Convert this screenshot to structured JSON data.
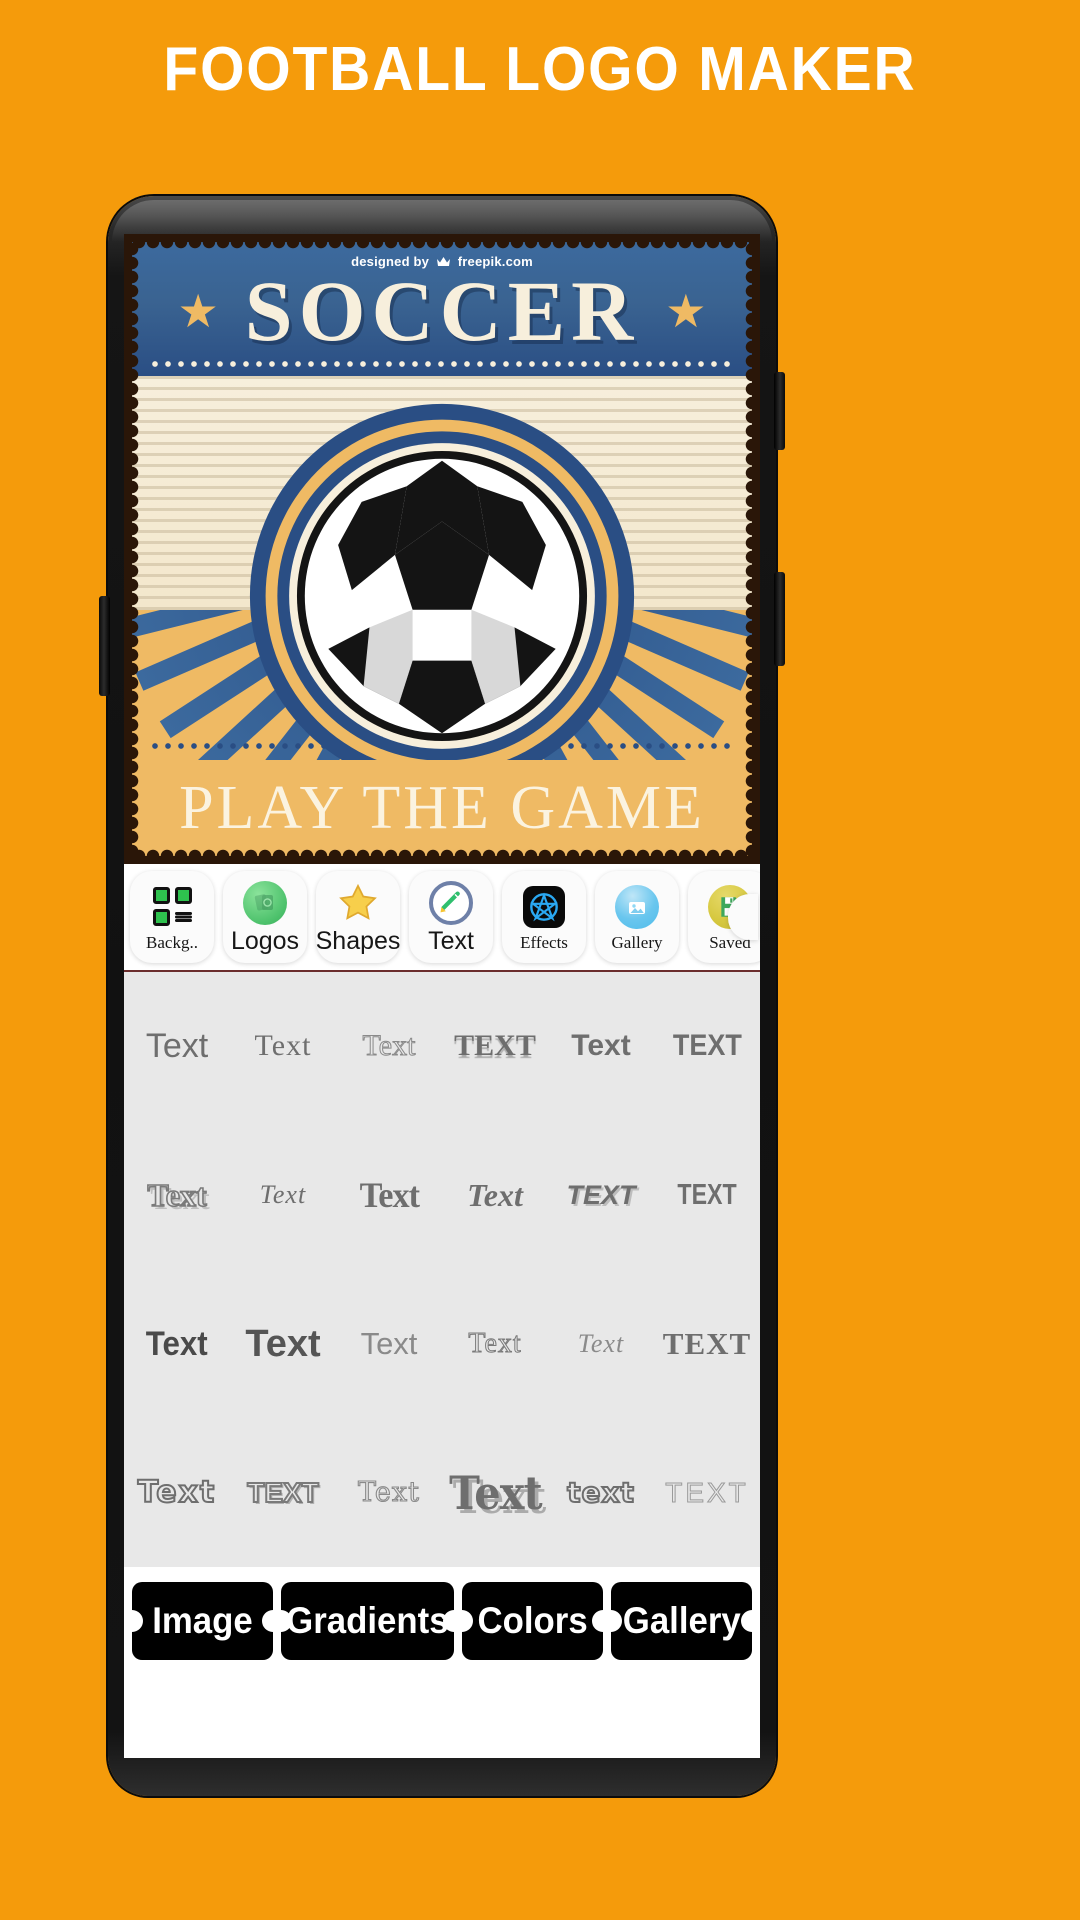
{
  "header": {
    "title": "FOOTBALL LOGO MAKER",
    "bg_color": "#F59B0B",
    "text_color": "#FFFFFF"
  },
  "poster": {
    "credit": "designed by",
    "credit_brand": "freepik.com",
    "title": "SOCCER",
    "subtitle": "PLAY THE GAME",
    "star_left": "★",
    "star_right": "★",
    "colors": {
      "header_blue": "#2A4E84",
      "cream": "#F7EFDC",
      "sand": "#EFBA64",
      "frame_brown": "#2A1608"
    }
  },
  "toolbar": {
    "items": [
      {
        "label": "Backg..",
        "icon": "grid-icon",
        "name": "background"
      },
      {
        "label": "Logos",
        "icon": "logos-icon",
        "name": "logos"
      },
      {
        "label": "Shapes",
        "icon": "star-icon",
        "name": "shapes"
      },
      {
        "label": "Text",
        "icon": "pencil-icon",
        "name": "text"
      },
      {
        "label": "Effects",
        "icon": "effects-icon",
        "name": "effects"
      },
      {
        "label": "Gallery",
        "icon": "gallery-icon",
        "name": "gallery"
      },
      {
        "label": "Saved",
        "icon": "floppy-icon",
        "name": "saved"
      }
    ],
    "selected": "Text"
  },
  "font_grid": {
    "sample_word": "Text",
    "text_color": "#6E6E6E",
    "bg_color": "#E8E8E8",
    "rows": 4,
    "columns": 6,
    "cells": [
      {
        "text": "Text",
        "style": "sans-regular"
      },
      {
        "text": "Text",
        "style": "thin-serif"
      },
      {
        "text": "Text",
        "style": "outline-serif"
      },
      {
        "text": "TEXT",
        "style": "drip-smallcaps"
      },
      {
        "text": "Text",
        "style": "sans-bold"
      },
      {
        "text": "TEXT",
        "style": "condensed-caps"
      },
      {
        "text": "Text",
        "style": "outline-shadow"
      },
      {
        "text": "Text",
        "style": "script-light"
      },
      {
        "text": "Text",
        "style": "heavy-slab"
      },
      {
        "text": "Text",
        "style": "script-bold-italic"
      },
      {
        "text": "TEXT",
        "style": "italic-caps-shadow"
      },
      {
        "text": "TEXT",
        "style": "narrow-caps"
      },
      {
        "text": "Text",
        "style": "bold-condensed"
      },
      {
        "text": "Text",
        "style": "extra-bold"
      },
      {
        "text": "Text",
        "style": "light-sans"
      },
      {
        "text": "Text",
        "style": "dotted-serif"
      },
      {
        "text": "Text",
        "style": "thin-handwritten"
      },
      {
        "text": "TEXT",
        "style": "rough-caps"
      },
      {
        "text": "Text",
        "style": "bubble-rounded"
      },
      {
        "text": "TEXT",
        "style": "sketch-caps"
      },
      {
        "text": "Text",
        "style": "blackletter"
      },
      {
        "text": "Text",
        "style": "display-shadow-big"
      },
      {
        "text": "text",
        "style": "outline-bubble-lower"
      },
      {
        "text": "TEXT",
        "style": "dashed-outline-caps"
      }
    ]
  },
  "bottom_tabs": {
    "items": [
      {
        "label": "Image"
      },
      {
        "label": "Gradients"
      },
      {
        "label": "Colors"
      },
      {
        "label": "Gallery"
      }
    ]
  }
}
